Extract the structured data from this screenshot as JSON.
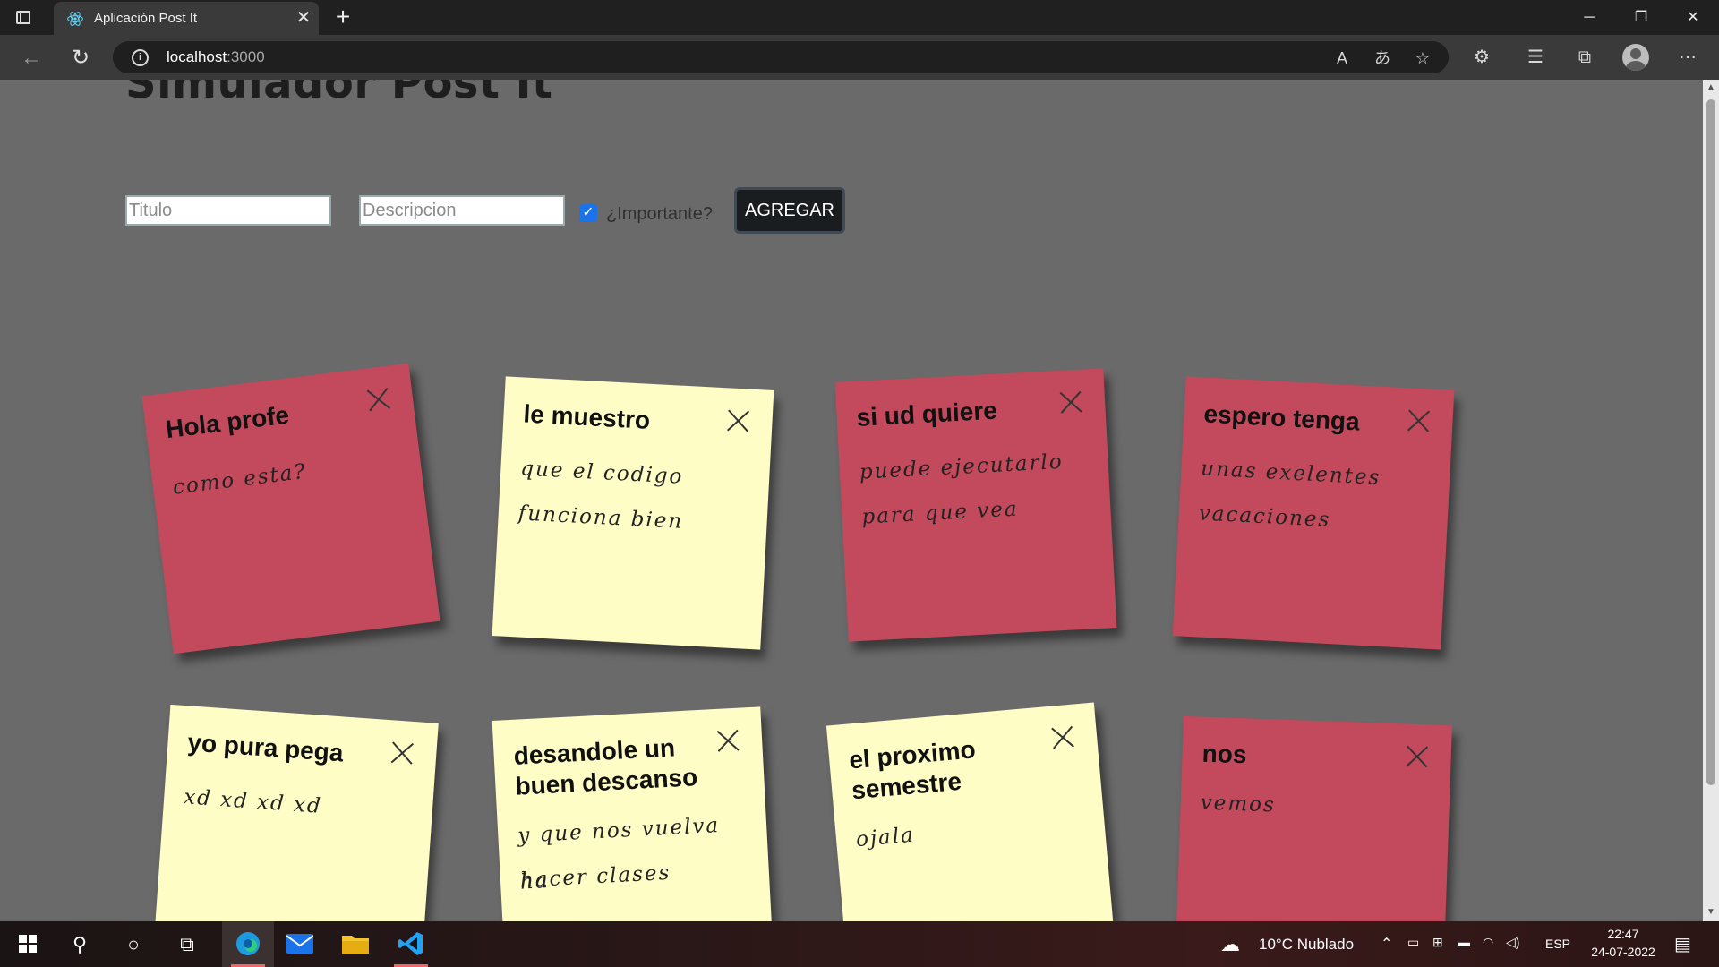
{
  "browser": {
    "tab_title": "Aplicación Post It",
    "url_host": "localhost",
    "url_port": ":3000"
  },
  "app": {
    "title": "Simulador Post It",
    "titulo_placeholder": "Titulo",
    "descripcion_placeholder": "Descripcion",
    "important_label": "¿Importante?",
    "important_checked": true,
    "add_button": "AGREGAR"
  },
  "notes": [
    {
      "title": "Hola profe",
      "desc1": "como esta?",
      "desc2": "",
      "important": true
    },
    {
      "title": "le muestro",
      "desc1": "que el codigo",
      "desc2": "funciona bien",
      "important": false
    },
    {
      "title": "si ud quiere",
      "desc1": "puede ejecutarlo",
      "desc2": "para que vea",
      "important": true
    },
    {
      "title": "espero tenga",
      "desc1": "unas exelentes",
      "desc2": "vacaciones",
      "important": true
    },
    {
      "title": "yo pura pega",
      "desc1": "xd xd xd xd",
      "desc2": "",
      "important": false
    },
    {
      "title": "desandole un buen descanso",
      "desc1": "y que nos vuelva ha",
      "desc2": "hacer clases",
      "important": false
    },
    {
      "title": "el proximo semestre",
      "desc1": "ojala",
      "desc2": "",
      "important": false
    },
    {
      "title": "nos",
      "desc1": "vemos",
      "desc2": "",
      "important": true
    }
  ],
  "taskbar": {
    "weather": "10°C  Nublado",
    "language": "ESP",
    "time": "22:47",
    "date": "24-07-2022"
  },
  "colors": {
    "important_note": "#c34a5c",
    "normal_note": "#fffdc6",
    "page_bg": "#6a6a6a"
  }
}
